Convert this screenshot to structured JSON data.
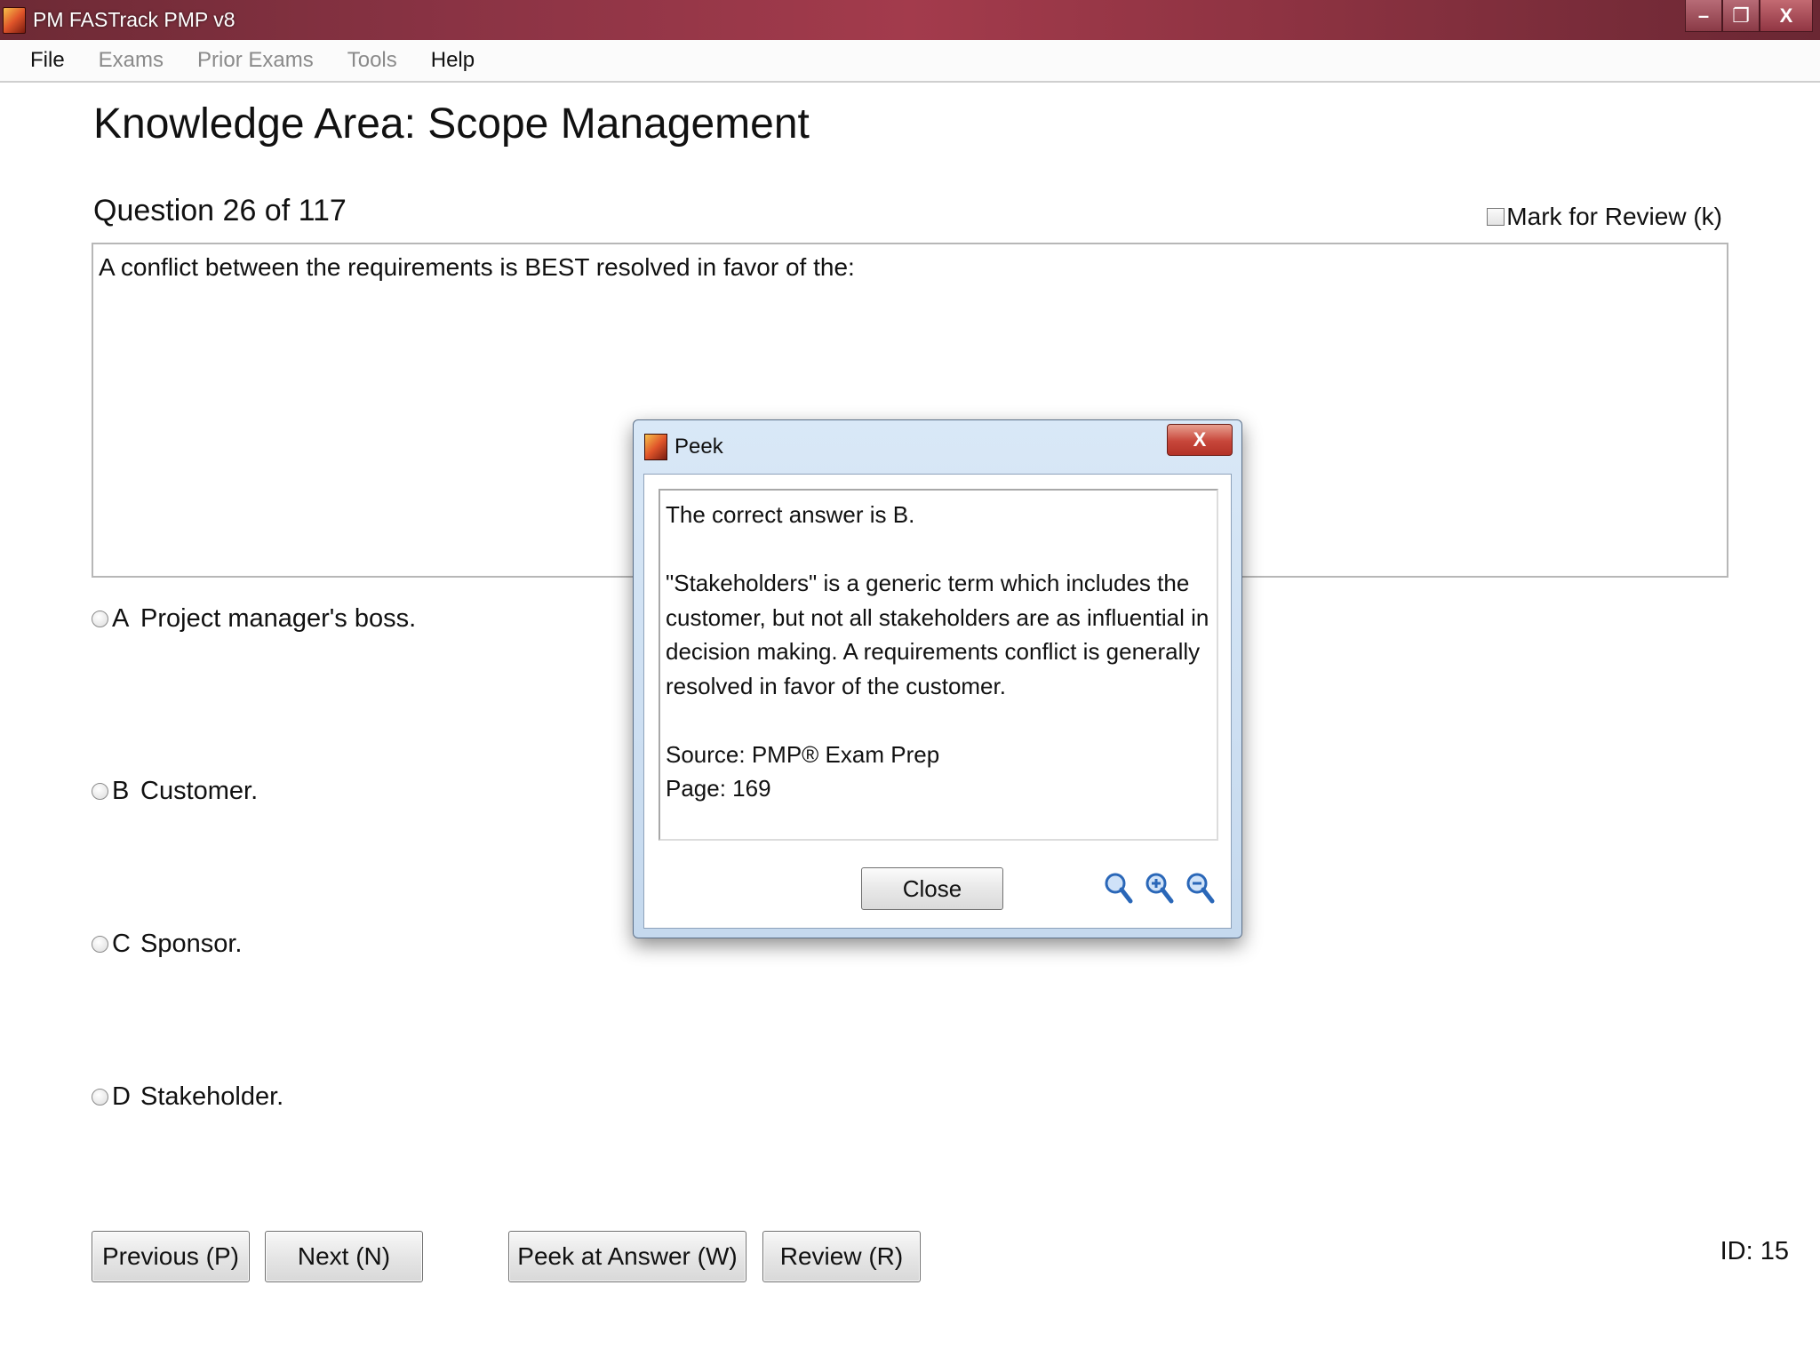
{
  "window": {
    "title": "PM FASTrack PMP v8",
    "controls": {
      "minimize": "–",
      "restore": "❐",
      "close": "X"
    }
  },
  "menu": {
    "items": [
      {
        "label": "File",
        "enabled": true
      },
      {
        "label": "Exams",
        "enabled": false
      },
      {
        "label": "Prior Exams",
        "enabled": false
      },
      {
        "label": "Tools",
        "enabled": false
      },
      {
        "label": "Help",
        "enabled": true
      }
    ]
  },
  "main": {
    "title": "Knowledge Area: Scope Management",
    "question_counter": "Question 26 of 117",
    "mark_for_review": "Mark for Review (k)",
    "question_text": "A conflict between the requirements is BEST resolved in favor of the:",
    "options": [
      {
        "letter": "A",
        "text": "Project manager's boss."
      },
      {
        "letter": "B",
        "text": "Customer."
      },
      {
        "letter": "C",
        "text": "Sponsor."
      },
      {
        "letter": "D",
        "text": "Stakeholder."
      }
    ],
    "buttons": {
      "previous": "Previous (P)",
      "next": "Next (N)",
      "peek": "Peek at Answer (W)",
      "review": "Review (R)"
    },
    "id_label": "ID: 15"
  },
  "dialog": {
    "title": "Peek",
    "close_x": "X",
    "answer_line": "The correct answer is B.",
    "explanation": "\"Stakeholders\" is a generic term which includes the customer, but not all stakeholders are as influential in decision making. A requirements conflict is generally resolved in favor of the customer.",
    "source": "Source: PMP® Exam Prep",
    "page": "Page: 169",
    "close_button": "Close"
  },
  "colors": {
    "titlebar": "#8a3344",
    "dialog_frame": "#c5d9ee",
    "dialog_close": "#c7463a",
    "zoom_icon": "#2a67b8"
  }
}
